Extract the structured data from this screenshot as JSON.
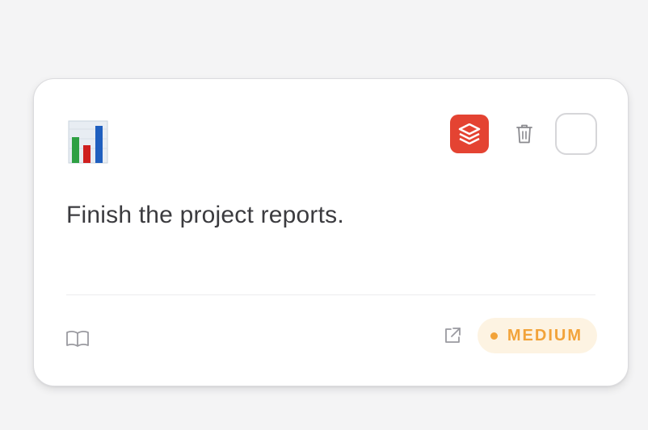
{
  "task": {
    "emoji_icon": "bar-chart-icon",
    "text": "Finish the project reports.",
    "integration_icon": "todoist-icon",
    "priority": {
      "label": "MEDIUM",
      "color": "#f2a33a",
      "background": "#fdf3e2"
    }
  },
  "colors": {
    "todoist": "#e44332",
    "page_background": "#f4f4f5",
    "card_background": "#ffffff"
  }
}
